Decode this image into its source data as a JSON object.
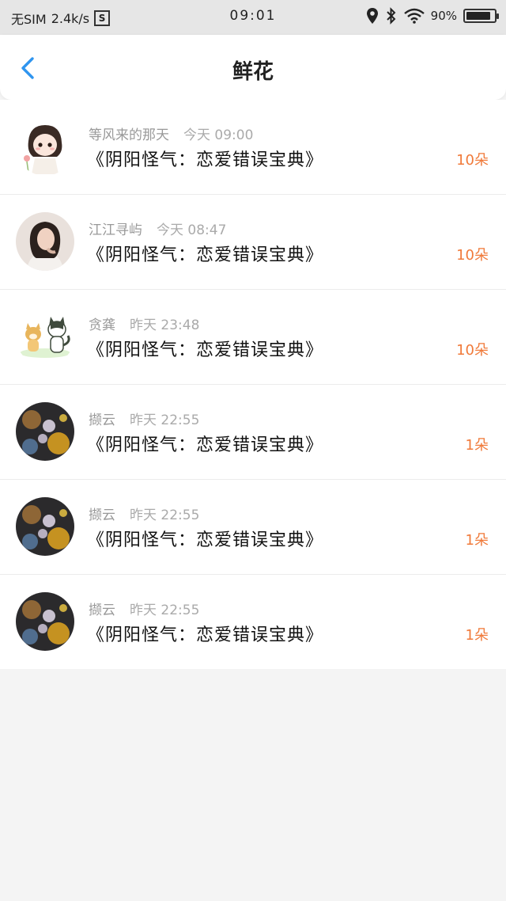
{
  "status_bar": {
    "sim": "无SIM",
    "speed": "2.4k/s",
    "sim_badge": "S",
    "time": "09:01",
    "battery": "90%",
    "battery_level": 0.9
  },
  "nav": {
    "title": "鲜花"
  },
  "items": [
    {
      "name": "等风来的那天",
      "time": "今天 09:00",
      "title": "《阴阳怪气：恋爱错误宝典》",
      "flowers": "10朵",
      "avatar": "girl-cartoon"
    },
    {
      "name": "江江寻屿",
      "time": "今天 08:47",
      "title": "《阴阳怪气：恋爱错误宝典》",
      "flowers": "10朵",
      "avatar": "woman-photo"
    },
    {
      "name": "贪龚",
      "time": "昨天 23:48",
      "title": "《阴阳怪气：恋爱错误宝典》",
      "flowers": "10朵",
      "avatar": "dog-cat-cartoon"
    },
    {
      "name": "撷云",
      "time": "昨天 22:55",
      "title": "《阴阳怪气：恋爱错误宝典》",
      "flowers": "1朵",
      "avatar": "night-flower-photo"
    },
    {
      "name": "撷云",
      "time": "昨天 22:55",
      "title": "《阴阳怪气：恋爱错误宝典》",
      "flowers": "1朵",
      "avatar": "night-flower-photo"
    },
    {
      "name": "撷云",
      "time": "昨天 22:55",
      "title": "《阴阳怪气：恋爱错误宝典》",
      "flowers": "1朵",
      "avatar": "night-flower-photo"
    }
  ]
}
